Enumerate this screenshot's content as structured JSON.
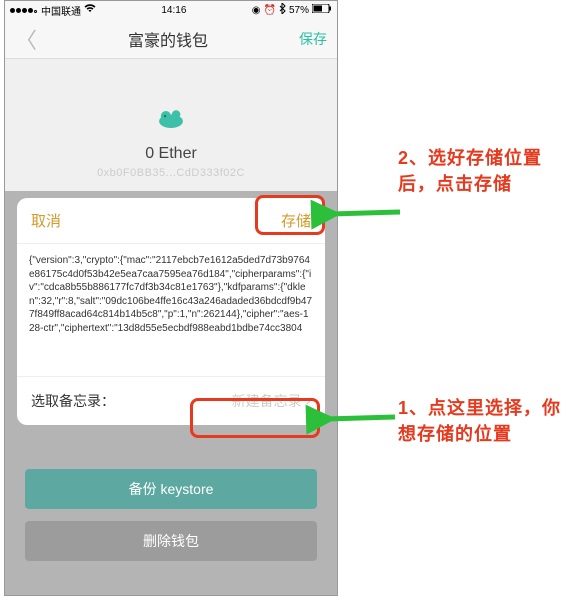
{
  "statusbar": {
    "carrier": "中国联通",
    "time": "14:16",
    "battery": "57%"
  },
  "navbar": {
    "title": "富豪的钱包",
    "save": "保存"
  },
  "wallet": {
    "balance": "0 Ether",
    "address": "0xb0F0BB35...CdD333f02C"
  },
  "sheet": {
    "cancel": "取消",
    "store": "存储",
    "keystore": "{\"version\":3,\"crypto\":{\"mac\":\"2117ebcb7e1612a5ded7d73b9764e86175c4d0f53b42e5ea7caa7595ea76d184\",\"cipherparams\":{\"iv\":\"cdca8b55b886177fc7df3b34c81e1763\"},\"kdfparams\":{\"dklen\":32,\"r\":8,\"salt\":\"09dc106be4ffe16c43a246adaded36bdcdf9b477f849ff8acad64c814b14b5c8\",\"p\":1,\"n\":262144},\"cipher\":\"aes-128-ctr\",\"ciphertext\":\"13d8d55e5ecbdf988eabd1bdbe74cc3804",
    "memo_label": "选取备忘录：",
    "memo_value": "新建备忘录"
  },
  "buttons": {
    "backup": "备份 keystore",
    "delete": "删除钱包"
  },
  "annotations": {
    "a2": "2、选好存储位置后，点击存储",
    "a1": "1、点这里选择，你想存储的位置"
  }
}
